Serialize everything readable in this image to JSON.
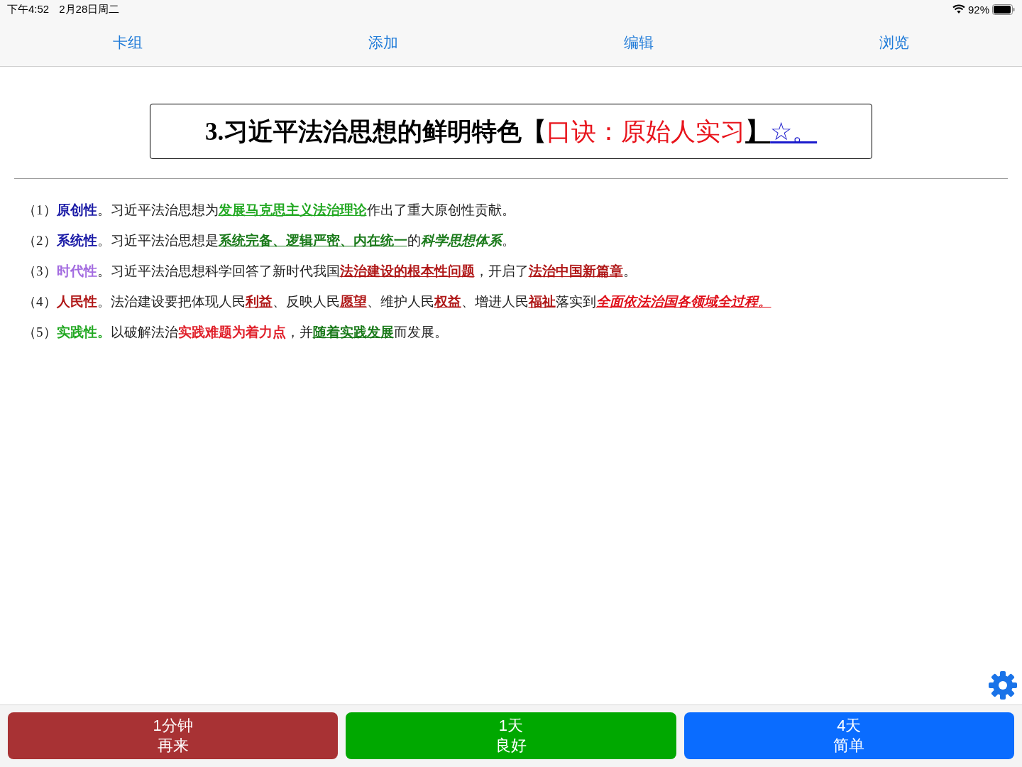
{
  "status_bar": {
    "time": "下午4:52",
    "date": "2月28日周二",
    "battery": "92%"
  },
  "tabs": [
    {
      "label": "卡组"
    },
    {
      "label": "添加"
    },
    {
      "label": "编辑"
    },
    {
      "label": "浏览"
    }
  ],
  "card": {
    "title": [
      {
        "text": "3.习近平法治思想的鲜明特色【",
        "color": "#000000",
        "bold": true,
        "underline": false,
        "italic": false
      },
      {
        "text": "口诀：原始人实习",
        "color": "#e8141c",
        "bold": false,
        "underline": false,
        "italic": false
      },
      {
        "text": "】",
        "color": "#000000",
        "bold": true,
        "underline": true,
        "italic": false
      },
      {
        "text": "☆。",
        "color": "#1a1acc",
        "bold": false,
        "underline": true,
        "italic": false
      }
    ],
    "lines": [
      [
        {
          "text": "（1）",
          "bold": false,
          "underline": false,
          "italic": false
        },
        {
          "text": "原创性",
          "color": "#1a1aa6",
          "bold": true,
          "underline": false,
          "italic": false
        },
        {
          "text": "。习近平法治思想为",
          "bold": false,
          "underline": false,
          "italic": false
        },
        {
          "text": "发展马克思主义法治理论",
          "color": "#22a822",
          "bold": true,
          "underline": true,
          "italic": false
        },
        {
          "text": "作出了重大原创性贡献。",
          "bold": false,
          "underline": false,
          "italic": false
        }
      ],
      [
        {
          "text": "（2）",
          "bold": false,
          "underline": false,
          "italic": false
        },
        {
          "text": "系统性",
          "color": "#1a1aa6",
          "bold": true,
          "underline": false,
          "italic": false
        },
        {
          "text": "。习近平法治思想是",
          "bold": false,
          "underline": false,
          "italic": false
        },
        {
          "text": "系统完备、逻辑严密、内在统一",
          "color": "#1a7a1a",
          "bold": true,
          "underline": true,
          "italic": false
        },
        {
          "text": "的",
          "bold": false,
          "underline": false,
          "italic": false
        },
        {
          "text": "科学思想体系",
          "color": "#1a7a1a",
          "bold": true,
          "underline": false,
          "italic": true
        },
        {
          "text": "。",
          "bold": false,
          "underline": false,
          "italic": false
        }
      ],
      [
        {
          "text": "（3）",
          "bold": false,
          "underline": false,
          "italic": false
        },
        {
          "text": "时代性",
          "color": "#a36be0",
          "bold": true,
          "underline": false,
          "italic": false
        },
        {
          "text": "。习近平法治思想科学回答了新时代我国",
          "bold": false,
          "underline": false,
          "italic": false
        },
        {
          "text": "法治建设的根本性问题",
          "color": "#b01818",
          "bold": true,
          "underline": true,
          "italic": false
        },
        {
          "text": "，开启了",
          "bold": false,
          "underline": false,
          "italic": false
        },
        {
          "text": "法治中国新篇章",
          "color": "#b01818",
          "bold": true,
          "underline": true,
          "italic": false
        },
        {
          "text": "。",
          "bold": false,
          "underline": false,
          "italic": false
        }
      ],
      [
        {
          "text": "（4）",
          "bold": false,
          "underline": false,
          "italic": false
        },
        {
          "text": "人民性",
          "color": "#b01818",
          "bold": true,
          "underline": false,
          "italic": false
        },
        {
          "text": "。法治建设要把体现人民",
          "bold": false,
          "underline": false,
          "italic": false
        },
        {
          "text": "利益",
          "color": "#b01818",
          "bold": true,
          "underline": true,
          "italic": false
        },
        {
          "text": "、反映人民",
          "bold": false,
          "underline": false,
          "italic": false
        },
        {
          "text": "愿望",
          "color": "#b01818",
          "bold": true,
          "underline": true,
          "italic": false
        },
        {
          "text": "、维护人民",
          "bold": false,
          "underline": false,
          "italic": false
        },
        {
          "text": "权益",
          "color": "#b01818",
          "bold": true,
          "underline": true,
          "italic": false
        },
        {
          "text": "、增进人民",
          "bold": false,
          "underline": false,
          "italic": false
        },
        {
          "text": "福祉",
          "color": "#b01818",
          "bold": true,
          "underline": true,
          "italic": false
        },
        {
          "text": "落实到",
          "bold": false,
          "underline": false,
          "italic": false
        },
        {
          "text": "全面依法治国各领域全过程。",
          "color": "#e0101a",
          "bold": true,
          "underline": true,
          "italic": true
        }
      ],
      [
        {
          "text": "（5）",
          "bold": false,
          "underline": false,
          "italic": false
        },
        {
          "text": "实践性。",
          "color": "#22a822",
          "bold": true,
          "underline": false,
          "italic": false
        },
        {
          "text": "以破解法治",
          "bold": false,
          "underline": false,
          "italic": false
        },
        {
          "text": "实践难题为着力点",
          "color": "#e0202a",
          "bold": true,
          "underline": false,
          "italic": false
        },
        {
          "text": "，并",
          "bold": false,
          "underline": false,
          "italic": false
        },
        {
          "text": "随着实践发展",
          "color": "#1a7a1a",
          "bold": true,
          "underline": true,
          "italic": false
        },
        {
          "text": "而发展。",
          "bold": false,
          "underline": false,
          "italic": false
        }
      ]
    ]
  },
  "answer_buttons": [
    {
      "interval": "1分钟",
      "label": "再来",
      "color": "#a83234"
    },
    {
      "interval": "1天",
      "label": "良好",
      "color": "#00a800"
    },
    {
      "interval": "4天",
      "label": "简单",
      "color": "#0a6cff"
    }
  ]
}
